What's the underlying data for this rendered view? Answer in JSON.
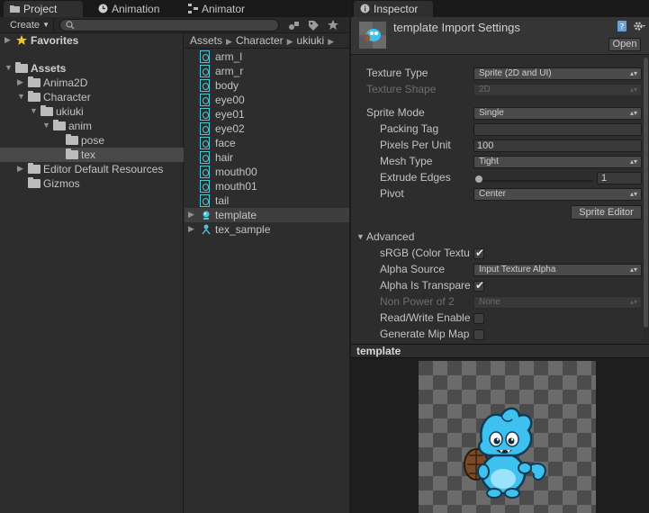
{
  "project": {
    "tabs": [
      {
        "label": "Project",
        "icon": "folder-icon",
        "active": true
      },
      {
        "label": "Animation",
        "icon": "animation-clock-icon",
        "active": false
      },
      {
        "label": "Animator",
        "icon": "animator-grid-icon",
        "active": false
      }
    ],
    "toolbar": {
      "create_label": "Create",
      "search_placeholder": ""
    },
    "tree": {
      "favorites": "Favorites",
      "assets": "Assets",
      "anima2d": "Anima2D",
      "character": "Character",
      "ukiuki": "ukiuki",
      "anim": "anim",
      "pose": "pose",
      "tex": "tex",
      "editor_default_resources": "Editor Default Resources",
      "gizmos": "Gizmos"
    },
    "breadcrumb": [
      "Assets",
      "Character",
      "ukiuki"
    ],
    "files": [
      {
        "label": "arm_l"
      },
      {
        "label": "arm_r"
      },
      {
        "label": "body"
      },
      {
        "label": "eye00"
      },
      {
        "label": "eye01"
      },
      {
        "label": "eye02"
      },
      {
        "label": "face"
      },
      {
        "label": "hair"
      },
      {
        "label": "mouth00"
      },
      {
        "label": "mouth01"
      },
      {
        "label": "tail"
      },
      {
        "label": "template"
      },
      {
        "label": "tex_sample"
      }
    ]
  },
  "inspector": {
    "tab_label": "Inspector",
    "title": "template Import Settings",
    "open_label": "Open",
    "props": {
      "texture_type": {
        "label": "Texture Type",
        "value": "Sprite (2D and UI)"
      },
      "texture_shape": {
        "label": "Texture Shape",
        "value": "2D"
      },
      "sprite_mode": {
        "label": "Sprite Mode",
        "value": "Single"
      },
      "packing_tag": {
        "label": "Packing Tag",
        "value": ""
      },
      "pixels_per_unit": {
        "label": "Pixels Per Unit",
        "value": "100"
      },
      "mesh_type": {
        "label": "Mesh Type",
        "value": "Tight"
      },
      "extrude_edges": {
        "label": "Extrude Edges",
        "value": "1"
      },
      "pivot": {
        "label": "Pivot",
        "value": "Center"
      },
      "sprite_editor_label": "Sprite Editor",
      "advanced_label": "Advanced",
      "srgb": {
        "label": "sRGB (Color Texture)",
        "checked": true
      },
      "alpha_source": {
        "label": "Alpha Source",
        "value": "Input Texture Alpha"
      },
      "alpha_transparency": {
        "label": "Alpha Is Transparency",
        "checked": true
      },
      "non_power_of_2": {
        "label": "Non Power of 2",
        "value": "None"
      },
      "read_write": {
        "label": "Read/Write Enabled",
        "checked": false
      },
      "generate_mip_maps": {
        "label": "Generate Mip Maps",
        "checked": false
      }
    }
  },
  "preview": {
    "title": "template"
  },
  "colors": {
    "favorites_star": "#f2c52b",
    "sprite_icon": "#4fc3d8",
    "mascot_body": "#3fc1ef"
  }
}
